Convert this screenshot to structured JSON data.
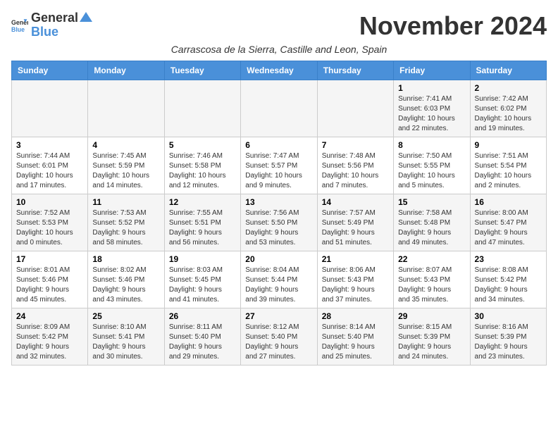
{
  "header": {
    "logo_general": "General",
    "logo_blue": "Blue",
    "month_title": "November 2024",
    "subtitle": "Carrascosa de la Sierra, Castille and Leon, Spain"
  },
  "weekdays": [
    "Sunday",
    "Monday",
    "Tuesday",
    "Wednesday",
    "Thursday",
    "Friday",
    "Saturday"
  ],
  "weeks": [
    [
      {
        "day": "",
        "info": ""
      },
      {
        "day": "",
        "info": ""
      },
      {
        "day": "",
        "info": ""
      },
      {
        "day": "",
        "info": ""
      },
      {
        "day": "",
        "info": ""
      },
      {
        "day": "1",
        "info": "Sunrise: 7:41 AM\nSunset: 6:03 PM\nDaylight: 10 hours\nand 22 minutes."
      },
      {
        "day": "2",
        "info": "Sunrise: 7:42 AM\nSunset: 6:02 PM\nDaylight: 10 hours\nand 19 minutes."
      }
    ],
    [
      {
        "day": "3",
        "info": "Sunrise: 7:44 AM\nSunset: 6:01 PM\nDaylight: 10 hours\nand 17 minutes."
      },
      {
        "day": "4",
        "info": "Sunrise: 7:45 AM\nSunset: 5:59 PM\nDaylight: 10 hours\nand 14 minutes."
      },
      {
        "day": "5",
        "info": "Sunrise: 7:46 AM\nSunset: 5:58 PM\nDaylight: 10 hours\nand 12 minutes."
      },
      {
        "day": "6",
        "info": "Sunrise: 7:47 AM\nSunset: 5:57 PM\nDaylight: 10 hours\nand 9 minutes."
      },
      {
        "day": "7",
        "info": "Sunrise: 7:48 AM\nSunset: 5:56 PM\nDaylight: 10 hours\nand 7 minutes."
      },
      {
        "day": "8",
        "info": "Sunrise: 7:50 AM\nSunset: 5:55 PM\nDaylight: 10 hours\nand 5 minutes."
      },
      {
        "day": "9",
        "info": "Sunrise: 7:51 AM\nSunset: 5:54 PM\nDaylight: 10 hours\nand 2 minutes."
      }
    ],
    [
      {
        "day": "10",
        "info": "Sunrise: 7:52 AM\nSunset: 5:53 PM\nDaylight: 10 hours\nand 0 minutes."
      },
      {
        "day": "11",
        "info": "Sunrise: 7:53 AM\nSunset: 5:52 PM\nDaylight: 9 hours\nand 58 minutes."
      },
      {
        "day": "12",
        "info": "Sunrise: 7:55 AM\nSunset: 5:51 PM\nDaylight: 9 hours\nand 56 minutes."
      },
      {
        "day": "13",
        "info": "Sunrise: 7:56 AM\nSunset: 5:50 PM\nDaylight: 9 hours\nand 53 minutes."
      },
      {
        "day": "14",
        "info": "Sunrise: 7:57 AM\nSunset: 5:49 PM\nDaylight: 9 hours\nand 51 minutes."
      },
      {
        "day": "15",
        "info": "Sunrise: 7:58 AM\nSunset: 5:48 PM\nDaylight: 9 hours\nand 49 minutes."
      },
      {
        "day": "16",
        "info": "Sunrise: 8:00 AM\nSunset: 5:47 PM\nDaylight: 9 hours\nand 47 minutes."
      }
    ],
    [
      {
        "day": "17",
        "info": "Sunrise: 8:01 AM\nSunset: 5:46 PM\nDaylight: 9 hours\nand 45 minutes."
      },
      {
        "day": "18",
        "info": "Sunrise: 8:02 AM\nSunset: 5:46 PM\nDaylight: 9 hours\nand 43 minutes."
      },
      {
        "day": "19",
        "info": "Sunrise: 8:03 AM\nSunset: 5:45 PM\nDaylight: 9 hours\nand 41 minutes."
      },
      {
        "day": "20",
        "info": "Sunrise: 8:04 AM\nSunset: 5:44 PM\nDaylight: 9 hours\nand 39 minutes."
      },
      {
        "day": "21",
        "info": "Sunrise: 8:06 AM\nSunset: 5:43 PM\nDaylight: 9 hours\nand 37 minutes."
      },
      {
        "day": "22",
        "info": "Sunrise: 8:07 AM\nSunset: 5:43 PM\nDaylight: 9 hours\nand 35 minutes."
      },
      {
        "day": "23",
        "info": "Sunrise: 8:08 AM\nSunset: 5:42 PM\nDaylight: 9 hours\nand 34 minutes."
      }
    ],
    [
      {
        "day": "24",
        "info": "Sunrise: 8:09 AM\nSunset: 5:42 PM\nDaylight: 9 hours\nand 32 minutes."
      },
      {
        "day": "25",
        "info": "Sunrise: 8:10 AM\nSunset: 5:41 PM\nDaylight: 9 hours\nand 30 minutes."
      },
      {
        "day": "26",
        "info": "Sunrise: 8:11 AM\nSunset: 5:40 PM\nDaylight: 9 hours\nand 29 minutes."
      },
      {
        "day": "27",
        "info": "Sunrise: 8:12 AM\nSunset: 5:40 PM\nDaylight: 9 hours\nand 27 minutes."
      },
      {
        "day": "28",
        "info": "Sunrise: 8:14 AM\nSunset: 5:40 PM\nDaylight: 9 hours\nand 25 minutes."
      },
      {
        "day": "29",
        "info": "Sunrise: 8:15 AM\nSunset: 5:39 PM\nDaylight: 9 hours\nand 24 minutes."
      },
      {
        "day": "30",
        "info": "Sunrise: 8:16 AM\nSunset: 5:39 PM\nDaylight: 9 hours\nand 23 minutes."
      }
    ]
  ]
}
